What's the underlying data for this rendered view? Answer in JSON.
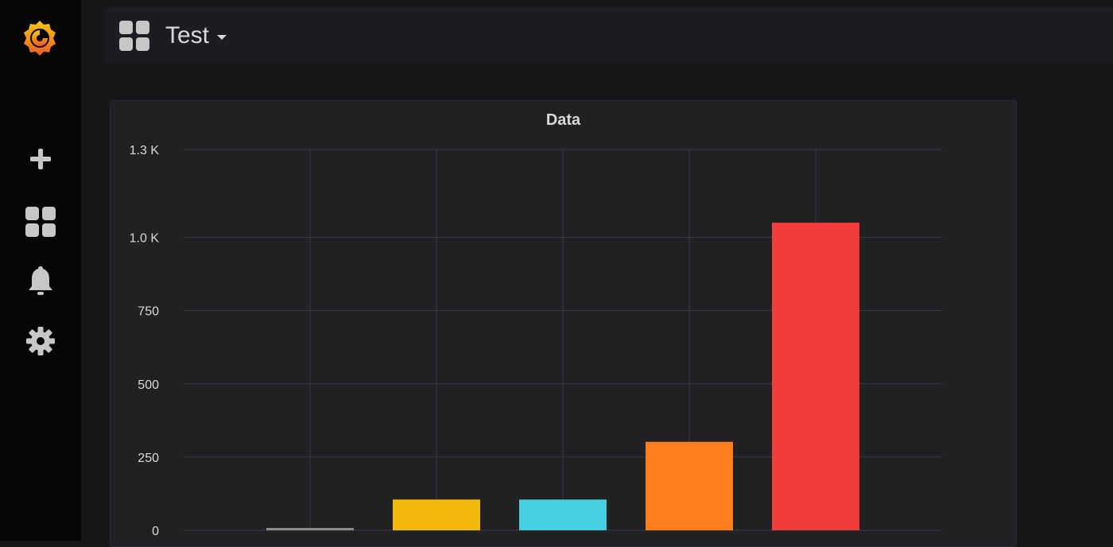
{
  "sidebar": {
    "items": [
      {
        "icon": "grafana-logo-icon"
      },
      {
        "icon": "plus-icon"
      },
      {
        "icon": "dashboards-icon"
      },
      {
        "icon": "bell-icon"
      },
      {
        "icon": "gear-icon"
      }
    ]
  },
  "navbar": {
    "dashboard_title": "Test",
    "icon": "dashboard-grid-icon"
  },
  "panel": {
    "title": "Data"
  },
  "colors": {
    "background": "#161719",
    "sidebar": "#060607",
    "panel": "#212124",
    "grid": "#3a3b3f",
    "text": "#d8d9da"
  },
  "chart_data": {
    "type": "bar",
    "title": "Data",
    "xlabel": "",
    "ylabel": "",
    "ylim": [
      0,
      1300
    ],
    "yticks": [
      {
        "value": 0,
        "label": "0"
      },
      {
        "value": 250,
        "label": "250"
      },
      {
        "value": 500,
        "label": "500"
      },
      {
        "value": 750,
        "label": "750"
      },
      {
        "value": 1000,
        "label": "1.0 K"
      },
      {
        "value": 1300,
        "label": "1.3 K"
      }
    ],
    "bars": [
      {
        "value": 8,
        "color": "#8e8e8e"
      },
      {
        "value": 105,
        "color": "#f2b90d"
      },
      {
        "value": 105,
        "color": "#44d0e0"
      },
      {
        "value": 302,
        "color": "#ff7f1f"
      },
      {
        "value": 1050,
        "color": "#f43c3c"
      }
    ],
    "grid": true
  }
}
